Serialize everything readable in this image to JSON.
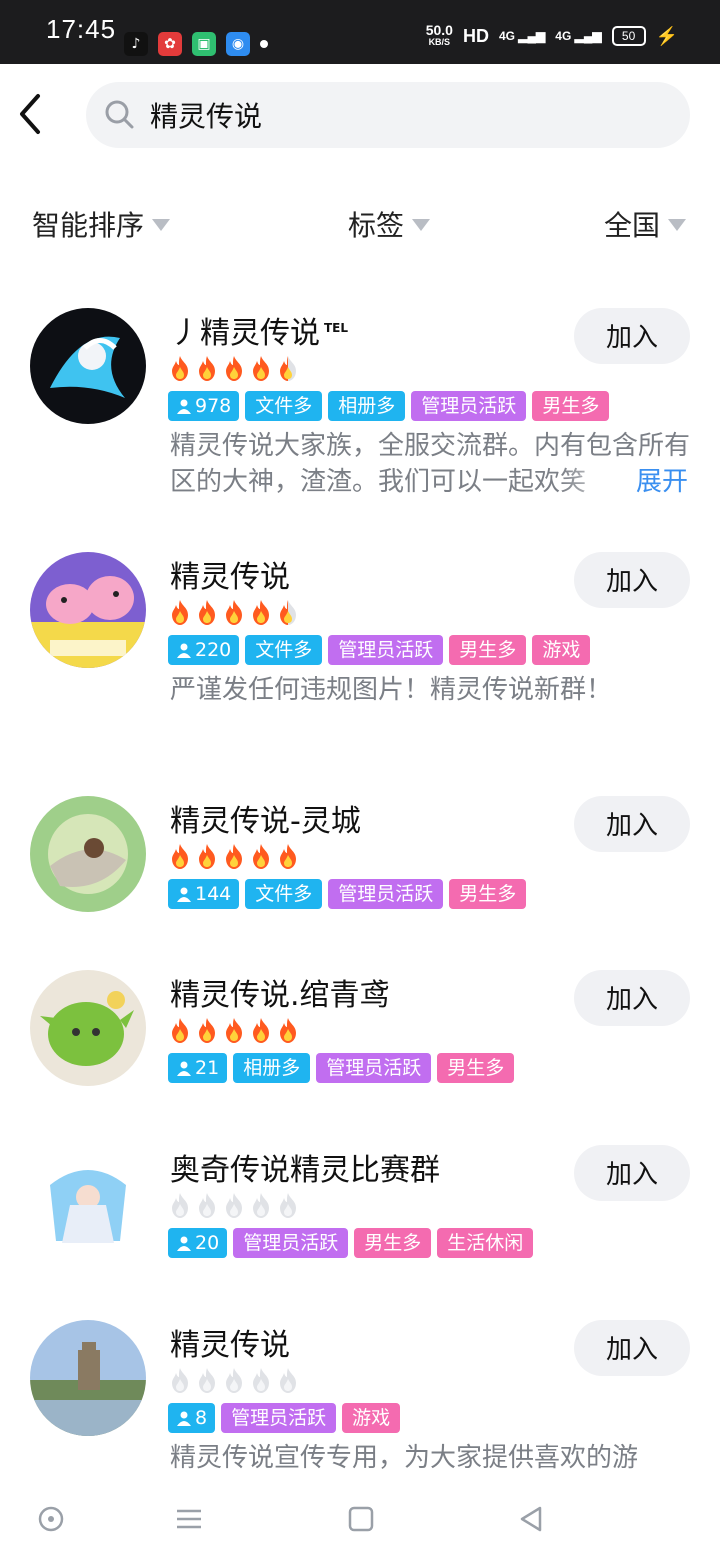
{
  "status": {
    "time": "17:45",
    "speed": "50.0",
    "speed_unit": "KB/S",
    "hd": "HD",
    "net1": "4G",
    "net2": "4G",
    "battery": "50"
  },
  "search": {
    "query": "精灵传说"
  },
  "filters": {
    "sort": "智能排序",
    "tags": "标签",
    "region": "全国"
  },
  "groups": [
    {
      "name": "丿精灵传说",
      "badge": "TEL",
      "flames": 4.5,
      "members": "978",
      "tags": [
        {
          "label": "文件多",
          "kind": "files"
        },
        {
          "label": "相册多",
          "kind": "photos"
        },
        {
          "label": "管理员活跃",
          "kind": "admin"
        },
        {
          "label": "男生多",
          "kind": "male"
        }
      ],
      "desc": "精灵传说大家族，全服交流群。内有包含所有区的大神，渣渣。我们可以一起欢笑",
      "expand": "展开",
      "join": "加入"
    },
    {
      "name": "精灵传说",
      "flames": 4.5,
      "members": "220",
      "tags": [
        {
          "label": "文件多",
          "kind": "files"
        },
        {
          "label": "管理员活跃",
          "kind": "admin"
        },
        {
          "label": "男生多",
          "kind": "male"
        },
        {
          "label": "游戏",
          "kind": "game"
        }
      ],
      "desc": "严谨发任何违规图片！精灵传说新群！",
      "join": "加入"
    },
    {
      "name": "精灵传说-灵城",
      "flames": 5,
      "members": "144",
      "tags": [
        {
          "label": "文件多",
          "kind": "files"
        },
        {
          "label": "管理员活跃",
          "kind": "admin"
        },
        {
          "label": "男生多",
          "kind": "male"
        }
      ],
      "join": "加入"
    },
    {
      "name": "精灵传说.绾青鸢",
      "flames": 5,
      "members": "21",
      "tags": [
        {
          "label": "相册多",
          "kind": "photos"
        },
        {
          "label": "管理员活跃",
          "kind": "admin"
        },
        {
          "label": "男生多",
          "kind": "male"
        }
      ],
      "join": "加入"
    },
    {
      "name": "奥奇传说精灵比赛群",
      "flames": 0,
      "members": "20",
      "tags": [
        {
          "label": "管理员活跃",
          "kind": "admin"
        },
        {
          "label": "男生多",
          "kind": "male"
        },
        {
          "label": "生活休闲",
          "kind": "leisure"
        }
      ],
      "join": "加入"
    },
    {
      "name": "精灵传说",
      "flames": 0,
      "members": "8",
      "tags": [
        {
          "label": "管理员活跃",
          "kind": "admin"
        },
        {
          "label": "游戏",
          "kind": "game"
        }
      ],
      "desc": "精灵传说宣传专用，为大家提供喜欢的游",
      "join": "加入"
    }
  ],
  "colors": {
    "tag_blue": "#1fb4f0",
    "tag_purple": "#c16ef0",
    "tag_pink": "#f46bb0",
    "flame": "#ff5a1f",
    "link": "#3a8ff0"
  },
  "icons": {
    "back": "chevron-left-icon",
    "search": "search-icon",
    "nav": [
      "home-circle-icon",
      "menu-icon",
      "square-icon",
      "back-triangle-icon"
    ]
  }
}
